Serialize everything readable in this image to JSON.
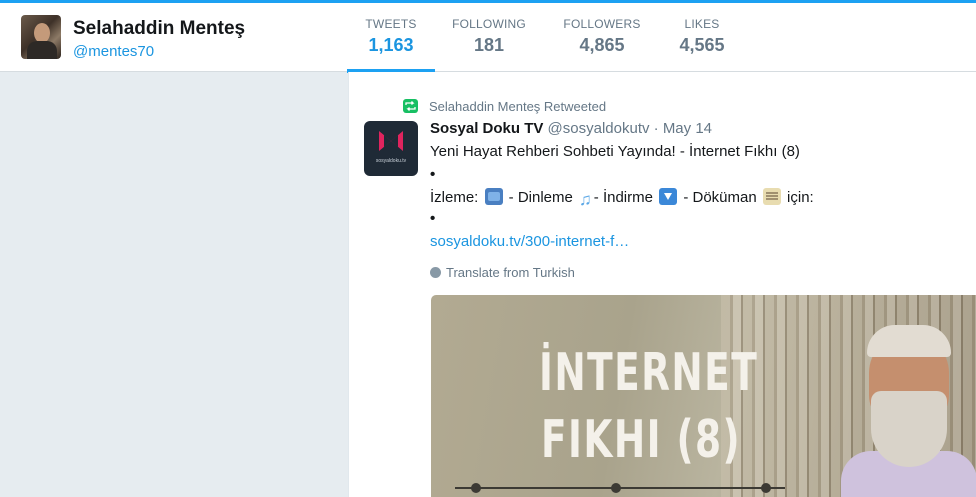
{
  "profile": {
    "name": "Selahaddin Menteş",
    "handle": "@mentes70"
  },
  "stats": [
    {
      "label": "TWEETS",
      "value": "1,163",
      "active": true
    },
    {
      "label": "FOLLOWING",
      "value": "181",
      "active": false
    },
    {
      "label": "FOLLOWERS",
      "value": "4,865",
      "active": false
    },
    {
      "label": "LIKES",
      "value": "4,565",
      "active": false
    }
  ],
  "tweet": {
    "retweet_context": "Selahaddin Menteş Retweeted",
    "author_name": "Sosyal Doku TV",
    "author_meta": "@sosyaldokutv · May 14",
    "avatar_caption": "sosyaldoku.tv",
    "line1": "Yeni Hayat Rehberi Sohbeti Yayında! - İnternet Fıkhı (8)",
    "bullet": "•",
    "line2_parts": [
      "İzleme: ",
      " - Dinleme ",
      "- İndirme ",
      " - Döküman ",
      " için:"
    ],
    "link": "sosyaldoku.tv/300-internet-f…",
    "translate": "Translate from Turkish",
    "icons": [
      "tv-icon",
      "musical-notes-icon",
      "down-arrow-icon",
      "memo-icon"
    ],
    "media": {
      "title_line1": "İNTERNET",
      "title_line2": "FIKHI (8)"
    }
  },
  "colors": {
    "accent": "#1da1f2",
    "link": "#1b95e0",
    "retweet": "#17bf63",
    "muted": "#657786",
    "background": "#e6ecf0"
  }
}
